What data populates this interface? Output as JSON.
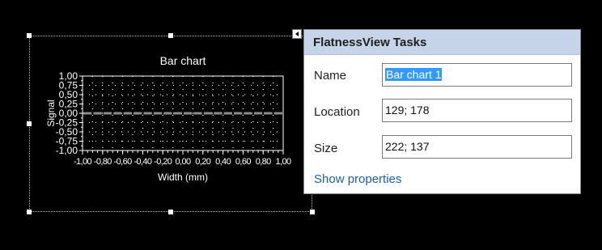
{
  "designer": {
    "chart": {
      "chart_data": {
        "type": "bar",
        "title": "Bar chart",
        "xlabel": "Width (mm)",
        "ylabel": "Signal",
        "xlim": [
          -1.0,
          1.0
        ],
        "ylim": [
          -1.0,
          1.0
        ],
        "x_tick_labels": [
          "-1,00",
          "-0,80",
          "-0,60",
          "-0,40",
          "-0,20",
          "0,00",
          "0,20",
          "0,40",
          "0,60",
          "0,80",
          "1,00"
        ],
        "y_tick_labels": [
          "1,00",
          "0,75",
          "0,50",
          "0,25",
          "0,00",
          "-0,25",
          "-0,50",
          "-0,75",
          "-1,00"
        ],
        "grid": true,
        "series": [
          {
            "values": [
              0,
              0,
              0,
              0,
              0,
              0,
              0,
              0,
              0,
              0,
              0,
              0,
              0,
              0,
              0,
              0,
              0,
              0,
              0,
              0
            ]
          }
        ]
      }
    }
  },
  "tasks_panel": {
    "title": "FlatnessView Tasks",
    "name_label": "Name",
    "name_value": "Bar chart 1",
    "location_label": "Location",
    "location_value": "129; 178",
    "size_label": "Size",
    "size_value": "222; 137",
    "show_properties": "Show properties"
  },
  "colors": {
    "header_bg": "#c5d4e8",
    "link": "#1f5fa8",
    "selection": "#3399ff"
  }
}
